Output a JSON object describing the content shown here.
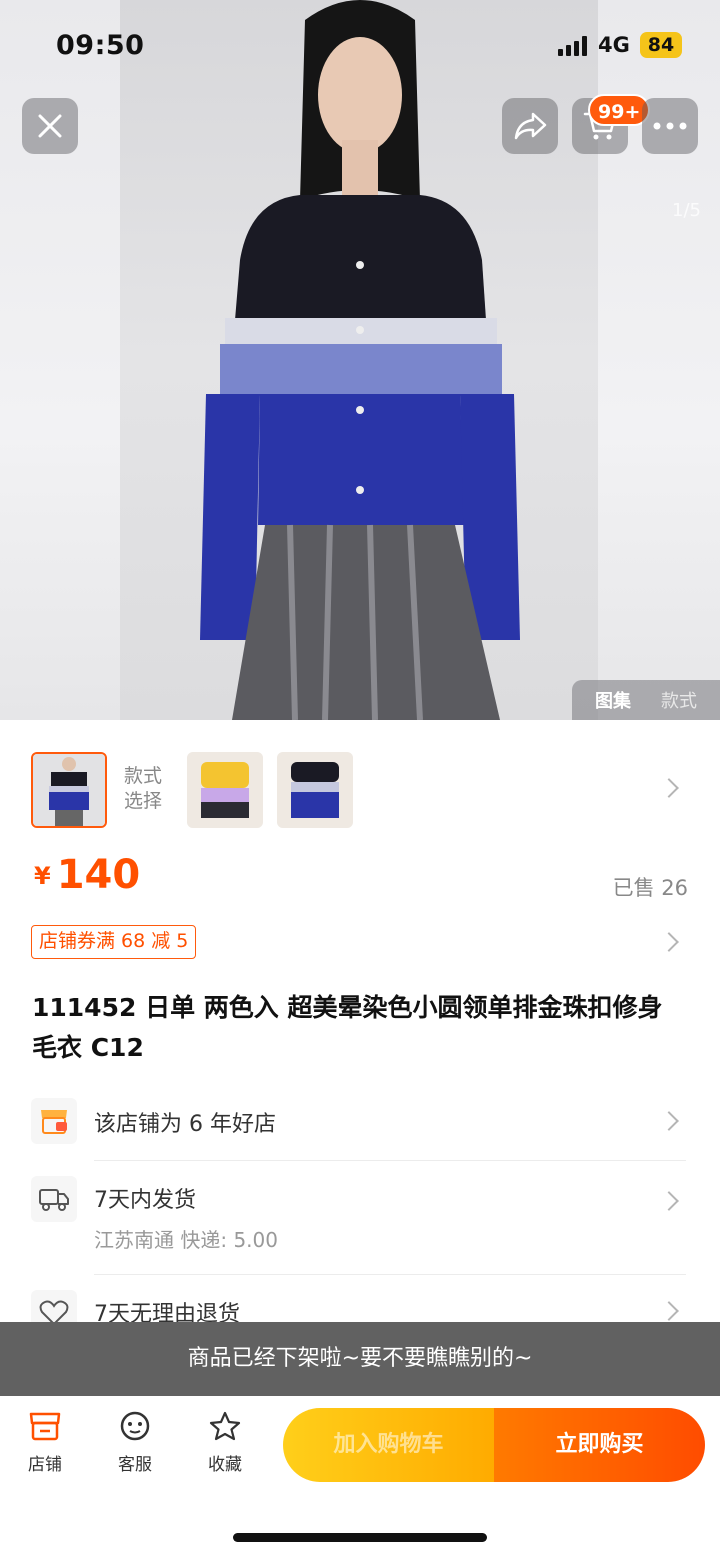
{
  "status_bar": {
    "time": "09:50",
    "network": "4G",
    "battery": "84"
  },
  "header": {
    "cart_badge": "99+",
    "page_indicator": "1/5"
  },
  "gallery_tabs": [
    {
      "label": "图集",
      "active": true
    },
    {
      "label": "款式",
      "active": false
    }
  ],
  "variants": {
    "label": "款式选择"
  },
  "price": {
    "currency": "¥",
    "amount": "140",
    "sold": "已售 26"
  },
  "coupon": {
    "label": "店铺券满 68 减 5"
  },
  "product": {
    "title": "111452 日单 两色入 超美晕染色小圆领单排金珠扣修身毛衣 C12"
  },
  "info_rows": [
    {
      "main": "该店铺为 6 年好店",
      "sub": ""
    },
    {
      "main": "7天内发货",
      "sub": "江苏南通  快递: 5.00"
    },
    {
      "main": "7天无理由退货",
      "sub": ""
    }
  ],
  "toast": {
    "text": "商品已经下架啦~要不要瞧瞧别的~"
  },
  "bottom_nav": {
    "shop": "店铺",
    "service": "客服",
    "favorite": "收藏"
  },
  "actions": {
    "add_to_cart": "加入购物车",
    "buy_now": "立即购买"
  },
  "colors": {
    "accent": "#ff5000",
    "cta_yellow": "#ffb800",
    "cta_orange": "#ff5a00"
  }
}
